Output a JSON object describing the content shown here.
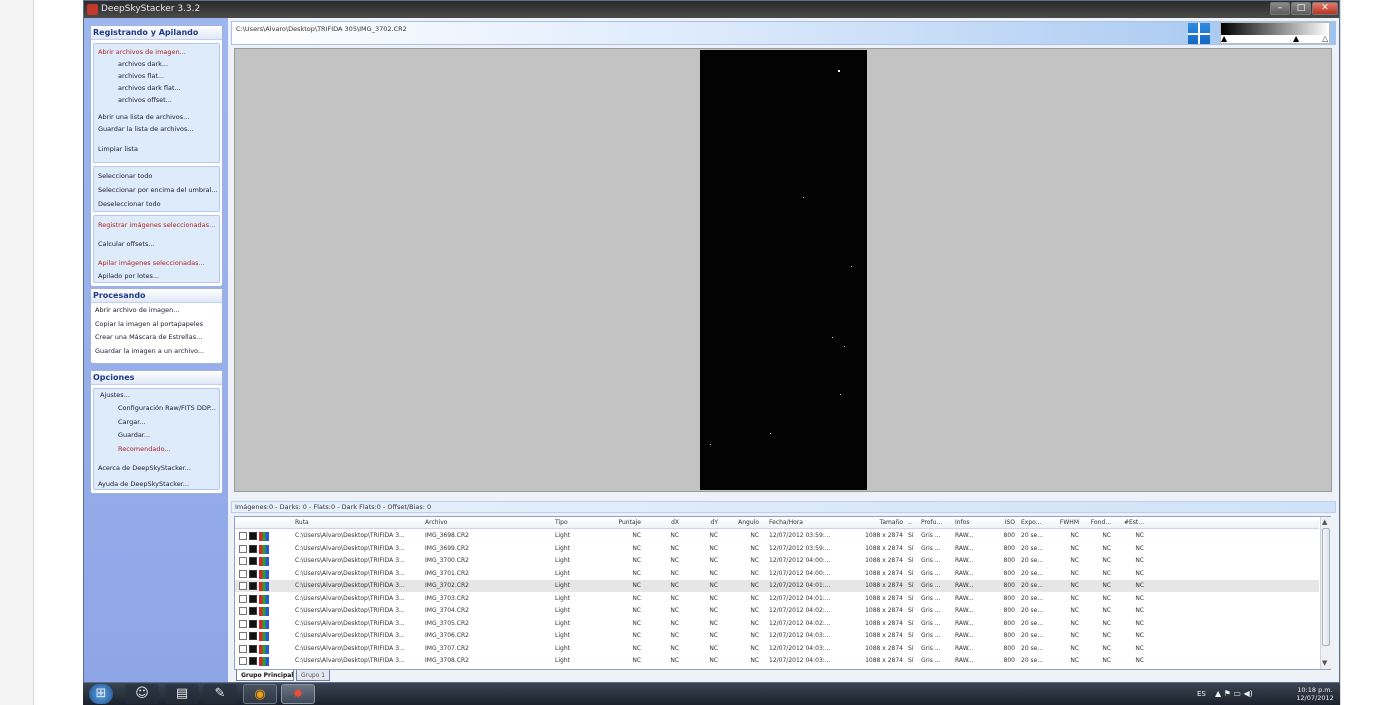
{
  "window": {
    "title": "DeepSkyStacker 3.3.2",
    "min": "–",
    "max": "□",
    "close": "✕"
  },
  "sidebar": {
    "register": {
      "header": "Registrando y Apilando",
      "open_images": "Abrir archivos de imagen...",
      "dark_files": "archivos dark...",
      "flat_files": "archivos flat...",
      "dark_flat_files": "archivos dark flat...",
      "offset_files": "archivos offset...",
      "open_list": "Abrir una lista de archivos...",
      "save_list": "Guardar la lista de archivos...",
      "clear_list": "Limpiar lista",
      "select_all": "Seleccionar todo",
      "select_threshold": "Seleccionar por encima del umbral...",
      "deselect_all": "Deseleccionar todo",
      "register_selected": "Registrar imágenes seleccionadas...",
      "compute_offsets": "Calcular offsets...",
      "stack_selected": "Apilar imágenes seleccionadas...",
      "batch_stack": "Apilado por lotes..."
    },
    "processing": {
      "header": "Procesando",
      "open_image": "Abrir archivo de imagen...",
      "copy_clipboard": "Copiar la imagen al portapapeles",
      "star_mask": "Crear una Máscara de Estrellas...",
      "save_image": "Guardar la imagen a un archivo..."
    },
    "options": {
      "header": "Opciones",
      "settings": "Ajustes...",
      "raw_settings": "Configuración Raw/FITS DDP...",
      "load": "Cargar...",
      "save": "Guardar...",
      "recommended": "Recomendado...",
      "about": "Acerca de DeepSkyStacker...",
      "help": "Ayuda de DeepSkyStacker..."
    }
  },
  "viewer": {
    "path": "C:\\Users\\Alvaro\\Desktop\\TRIFIDA 305\\IMG_3702.CR2",
    "hist_left": "▲",
    "hist_mid": "▲",
    "hist_right": "△",
    "tool_select": "⬚",
    "tool_star": "+",
    "tool_comet": "✶",
    "tool_save": "▭"
  },
  "status": {
    "counts": "Imágenes:0   -   Darks: 0   -   Flats:0   -   Dark Flats:0   -   Offset/Bias: 0"
  },
  "list": {
    "headers": [
      "Ruta",
      "Archivo",
      "Tipo",
      "Puntaje",
      "dX",
      "dY",
      "Angulo",
      "Fecha/Hora",
      "Tamaño",
      "..",
      "Profu...",
      "Infos",
      "ISO",
      "Expo...",
      "FWHM",
      "Fond...",
      "#Est..."
    ],
    "rows": [
      [
        "C:\\Users\\Alvaro\\Desktop\\TRIFIDA 3...",
        "IMG_3698.CR2",
        "Light",
        "NC",
        "NC",
        "NC",
        "NC",
        "12/07/2012 03:59:...",
        "1088 x 2874",
        "Sí",
        "Gris ...",
        "RAW...",
        "800",
        "20 se...",
        "NC",
        "NC",
        "NC"
      ],
      [
        "C:\\Users\\Alvaro\\Desktop\\TRIFIDA 3...",
        "IMG_3699.CR2",
        "Light",
        "NC",
        "NC",
        "NC",
        "NC",
        "12/07/2012 03:59:...",
        "1088 x 2874",
        "Sí",
        "Gris ...",
        "RAW...",
        "800",
        "20 se...",
        "NC",
        "NC",
        "NC"
      ],
      [
        "C:\\Users\\Alvaro\\Desktop\\TRIFIDA 3...",
        "IMG_3700.CR2",
        "Light",
        "NC",
        "NC",
        "NC",
        "NC",
        "12/07/2012 04:00:...",
        "1088 x 2874",
        "Sí",
        "Gris ...",
        "RAW...",
        "800",
        "20 se...",
        "NC",
        "NC",
        "NC"
      ],
      [
        "C:\\Users\\Alvaro\\Desktop\\TRIFIDA 3...",
        "IMG_3701.CR2",
        "Light",
        "NC",
        "NC",
        "NC",
        "NC",
        "12/07/2012 04:00:...",
        "1088 x 2874",
        "Sí",
        "Gris ...",
        "RAW...",
        "800",
        "20 se...",
        "NC",
        "NC",
        "NC"
      ],
      [
        "C:\\Users\\Alvaro\\Desktop\\TRIFIDA 3...",
        "IMG_3702.CR2",
        "Light",
        "NC",
        "NC",
        "NC",
        "NC",
        "12/07/2012 04:01:...",
        "1088 x 2874",
        "Sí",
        "Gris ...",
        "RAW...",
        "800",
        "20 se...",
        "NC",
        "NC",
        "NC"
      ],
      [
        "C:\\Users\\Alvaro\\Desktop\\TRIFIDA 3...",
        "IMG_3703.CR2",
        "Light",
        "NC",
        "NC",
        "NC",
        "NC",
        "12/07/2012 04:01:...",
        "1088 x 2874",
        "Sí",
        "Gris ...",
        "RAW...",
        "800",
        "20 se...",
        "NC",
        "NC",
        "NC"
      ],
      [
        "C:\\Users\\Alvaro\\Desktop\\TRIFIDA 3...",
        "IMG_3704.CR2",
        "Light",
        "NC",
        "NC",
        "NC",
        "NC",
        "12/07/2012 04:02:...",
        "1088 x 2874",
        "Sí",
        "Gris ...",
        "RAW...",
        "800",
        "20 se...",
        "NC",
        "NC",
        "NC"
      ],
      [
        "C:\\Users\\Alvaro\\Desktop\\TRIFIDA 3...",
        "IMG_3705.CR2",
        "Light",
        "NC",
        "NC",
        "NC",
        "NC",
        "12/07/2012 04:02:...",
        "1088 x 2874",
        "Sí",
        "Gris ...",
        "RAW...",
        "800",
        "20 se...",
        "NC",
        "NC",
        "NC"
      ],
      [
        "C:\\Users\\Alvaro\\Desktop\\TRIFIDA 3...",
        "IMG_3706.CR2",
        "Light",
        "NC",
        "NC",
        "NC",
        "NC",
        "12/07/2012 04:03:...",
        "1088 x 2874",
        "Sí",
        "Gris ...",
        "RAW...",
        "800",
        "20 se...",
        "NC",
        "NC",
        "NC"
      ],
      [
        "C:\\Users\\Alvaro\\Desktop\\TRIFIDA 3...",
        "IMG_3707.CR2",
        "Light",
        "NC",
        "NC",
        "NC",
        "NC",
        "12/07/2012 04:03:...",
        "1088 x 2874",
        "Sí",
        "Gris ...",
        "RAW...",
        "800",
        "20 se...",
        "NC",
        "NC",
        "NC"
      ],
      [
        "C:\\Users\\Alvaro\\Desktop\\TRIFIDA 3...",
        "IMG_3708.CR2",
        "Light",
        "NC",
        "NC",
        "NC",
        "NC",
        "12/07/2012 04:03:...",
        "1088 x 2874",
        "Sí",
        "Gris ...",
        "RAW...",
        "800",
        "20 se...",
        "NC",
        "NC",
        "NC"
      ]
    ],
    "selected_index": 4,
    "scroll_up": "▲",
    "scroll_down": "▼"
  },
  "tabs": {
    "main": "Grupo Principal",
    "group1": "Grupo 1"
  },
  "taskbar": {
    "language": "ES",
    "tray_icons": "▲  ⚑  ▭  ◀)",
    "time": "10:18 p.m.",
    "date": "12/07/2012",
    "start_glyph": "⊞",
    "people_glyph": "☺",
    "explorer_glyph": "▤",
    "edit_glyph": "✎",
    "firefox_glyph": "◉",
    "dss_glyph": "✸"
  },
  "colors": {
    "accent": "#1c3b8a",
    "red_link": "#b22222",
    "selection": "#e6e6e6",
    "sidebar": "#9fb7ef"
  }
}
